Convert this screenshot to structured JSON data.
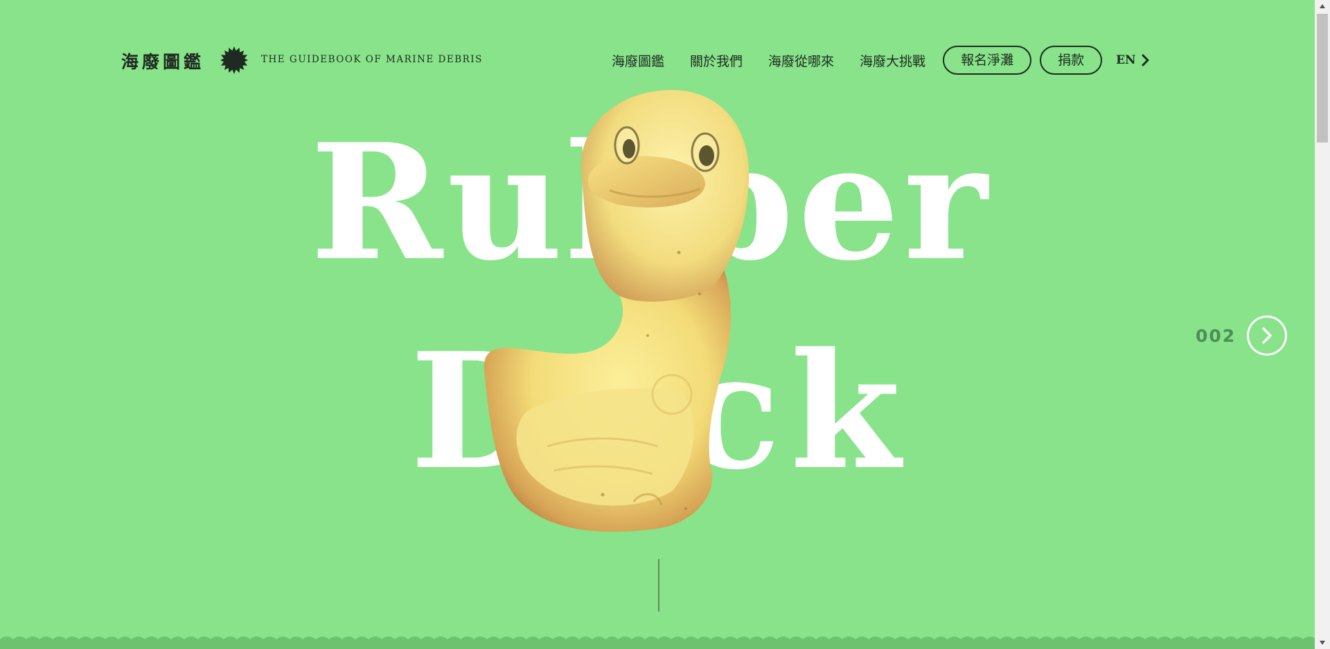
{
  "header": {
    "logo_zh": "海廢圖鑑",
    "logo_en": "THE GUIDEBOOK OF MARINE DEBRIS",
    "nav": [
      {
        "label": "海廢圖鑑"
      },
      {
        "label": "關於我們"
      },
      {
        "label": "海廢從哪來"
      },
      {
        "label": "海廢大挑戰"
      }
    ],
    "signup_label": "報名淨灘",
    "donate_label": "捐款",
    "lang_label": "EN"
  },
  "hero": {
    "line1": "Rubber",
    "line2": "Duck",
    "image_subject": "rubber-duck"
  },
  "pager": {
    "number": "002"
  },
  "colors": {
    "background": "#88e38a",
    "text_dark": "#1f2a22",
    "hero_text": "#ffffff",
    "pager_number": "#4b8f57"
  },
  "icons": {
    "logo_badge": "sun-badge-icon",
    "lang_arrow": "chevron-right-icon",
    "pager_next": "circle-chevron-right-icon"
  }
}
